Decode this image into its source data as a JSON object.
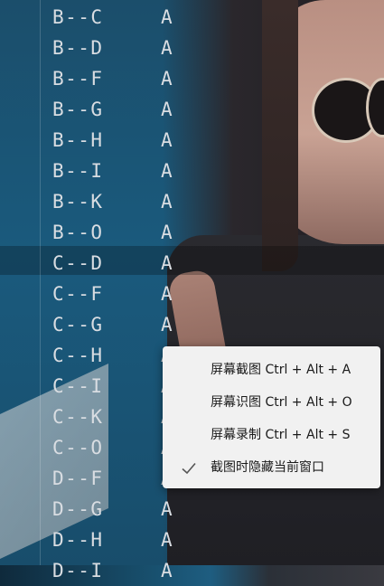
{
  "editor": {
    "lines": [
      {
        "left": "B--C",
        "right": "A"
      },
      {
        "left": "B--D",
        "right": "A"
      },
      {
        "left": "B--F",
        "right": "A"
      },
      {
        "left": "B--G",
        "right": "A"
      },
      {
        "left": "B--H",
        "right": "A"
      },
      {
        "left": "B--I",
        "right": "A"
      },
      {
        "left": "B--K",
        "right": "A"
      },
      {
        "left": "B--O",
        "right": "A"
      },
      {
        "left": "C--D",
        "right": "A"
      },
      {
        "left": "C--F",
        "right": "A"
      },
      {
        "left": "C--G",
        "right": "A"
      },
      {
        "left": "C--H",
        "right": "A"
      },
      {
        "left": "C--I",
        "right": "A"
      },
      {
        "left": "C--K",
        "right": "A"
      },
      {
        "left": "C--O",
        "right": "A"
      },
      {
        "left": "D--F",
        "right": "A"
      },
      {
        "left": "D--G",
        "right": "A"
      },
      {
        "left": "D--H",
        "right": "A"
      },
      {
        "left": "D--I",
        "right": "A"
      }
    ]
  },
  "context_menu": {
    "items": [
      {
        "label": "屏幕截图 Ctrl + Alt + A",
        "checked": false
      },
      {
        "label": "屏幕识图 Ctrl + Alt + O",
        "checked": false
      },
      {
        "label": "屏幕录制 Ctrl + Alt + S",
        "checked": false
      },
      {
        "label": "截图时隐藏当前窗口",
        "checked": true
      }
    ]
  }
}
